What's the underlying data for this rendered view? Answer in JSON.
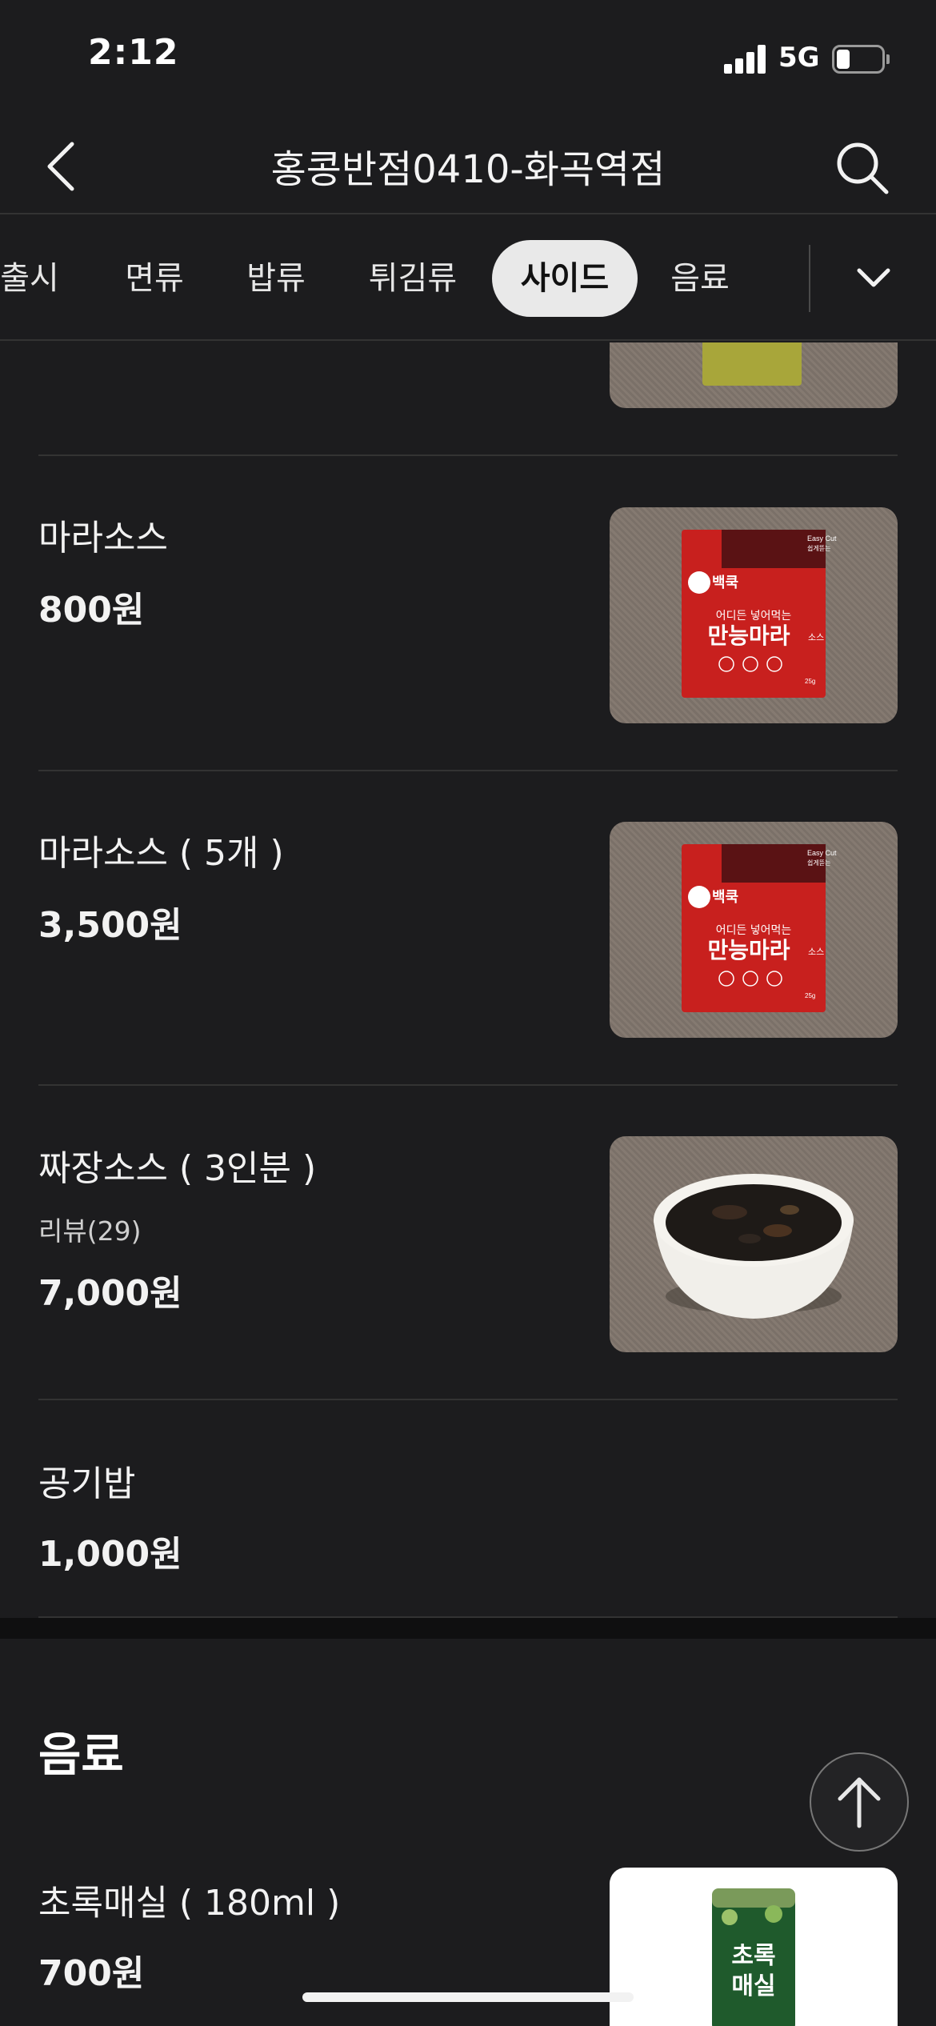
{
  "status_bar": {
    "time": "2:12",
    "network": "5G",
    "battery_level": 0.3
  },
  "header": {
    "title": "홍콩반점0410-화곡역점"
  },
  "tabs": [
    {
      "label": "출시",
      "active": false
    },
    {
      "label": "면류",
      "active": false
    },
    {
      "label": "밥류",
      "active": false
    },
    {
      "label": "튀김류",
      "active": false
    },
    {
      "label": "사이드",
      "active": true
    },
    {
      "label": "음료",
      "active": false
    }
  ],
  "menu_items": [
    {
      "name": "마라소스",
      "price": "800원",
      "image": "mala-sauce-packet"
    },
    {
      "name": "마라소스 ( 5개 )",
      "price": "3,500원",
      "image": "mala-sauce-packet"
    },
    {
      "name": "짜장소스 ( 3인분 )",
      "review": "리뷰(29)",
      "price": "7,000원",
      "image": "jjajang-sauce-bowl"
    },
    {
      "name": "공기밥",
      "price": "1,000원"
    }
  ],
  "drinks_section": {
    "title": "음료",
    "items": [
      {
        "name": "초록매실 ( 180ml )",
        "price": "700원",
        "image": "green-plum-drink-can"
      }
    ]
  },
  "packet_text": {
    "easy_cut": "Easy Cut",
    "easy_cut_sub": "쉽게뜯는",
    "brand": "백쿡",
    "tagline": "어디든 넣어먹는",
    "product": "만능마라",
    "product_suffix": "소스",
    "weight": "25g"
  },
  "can_text": {
    "line1": "초록",
    "line2": "매실"
  },
  "colors": {
    "background": "#1c1c1e",
    "active_tab": "#e9e9e9",
    "packet_red": "#c8201e"
  }
}
